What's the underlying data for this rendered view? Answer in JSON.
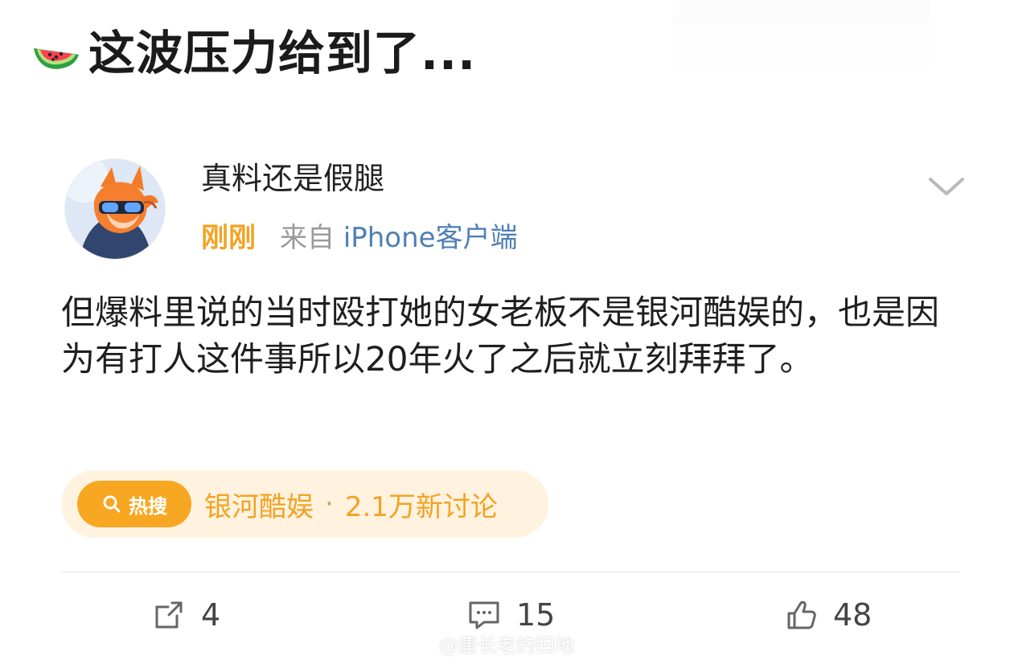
{
  "header": {
    "emoji_icon": "watermelon-icon",
    "title": "这波压力给到了..."
  },
  "post": {
    "author": {
      "name": "真料还是假腿",
      "avatar_icon": "fox-avatar-icon"
    },
    "meta": {
      "time": "刚刚",
      "source_prefix": "来自",
      "client": "iPhone客户端"
    },
    "menu_icon": "chevron-down-icon",
    "body": "但爆料里说的当时殴打她的女老板不是银河酷娱的，也是因为有打人这件事所以20年火了之后就立刻拜拜了。",
    "hot_search": {
      "badge_icon": "search-icon",
      "badge_label": "热搜",
      "topic": "银河酷娱",
      "separator": "·",
      "count_label": "2.1万新讨论"
    },
    "actions": {
      "repost": {
        "icon": "share-icon",
        "count": "4"
      },
      "comment": {
        "icon": "comment-icon",
        "count": "15"
      },
      "like": {
        "icon": "thumbs-up-icon",
        "count": "48"
      }
    }
  },
  "watermark": {
    "logo": "weibo-logo",
    "text": "@唐长老的田地"
  },
  "colors": {
    "accent": "#f2a323",
    "hot_badge": "#f7a721",
    "hot_background": "#fff2df",
    "source_link": "#4f7fb4",
    "text": "#1f1f1f"
  }
}
